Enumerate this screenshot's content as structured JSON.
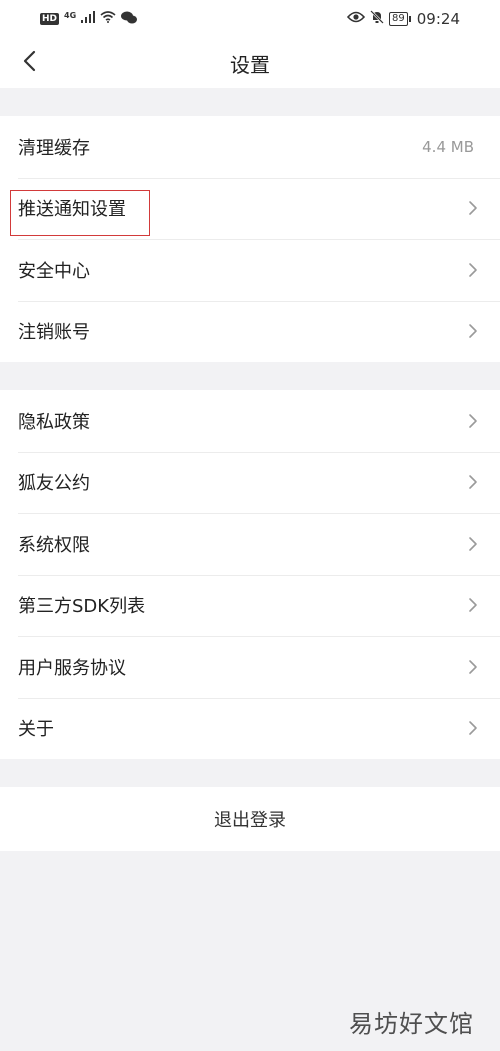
{
  "status_bar": {
    "hd": "HD",
    "network": "4G",
    "battery": "89",
    "time": "09:24"
  },
  "header": {
    "title": "设置",
    "back_icon": "chevron-left-icon"
  },
  "group1": {
    "items": [
      {
        "label": "清理缓存",
        "value": "4.4 MB"
      },
      {
        "label": "推送通知设置"
      },
      {
        "label": "安全中心"
      },
      {
        "label": "注销账号"
      }
    ]
  },
  "group2": {
    "items": [
      {
        "label": "隐私政策"
      },
      {
        "label": "狐友公约"
      },
      {
        "label": "系统权限"
      },
      {
        "label": "第三方SDK列表"
      },
      {
        "label": "用户服务协议"
      },
      {
        "label": "关于"
      }
    ]
  },
  "logout": {
    "label": "退出登录"
  },
  "watermark": "易坊好文馆",
  "colors": {
    "background": "#f2f2f4",
    "surface": "#ffffff",
    "highlight": "#d23a3a",
    "secondary_text": "#999999"
  }
}
